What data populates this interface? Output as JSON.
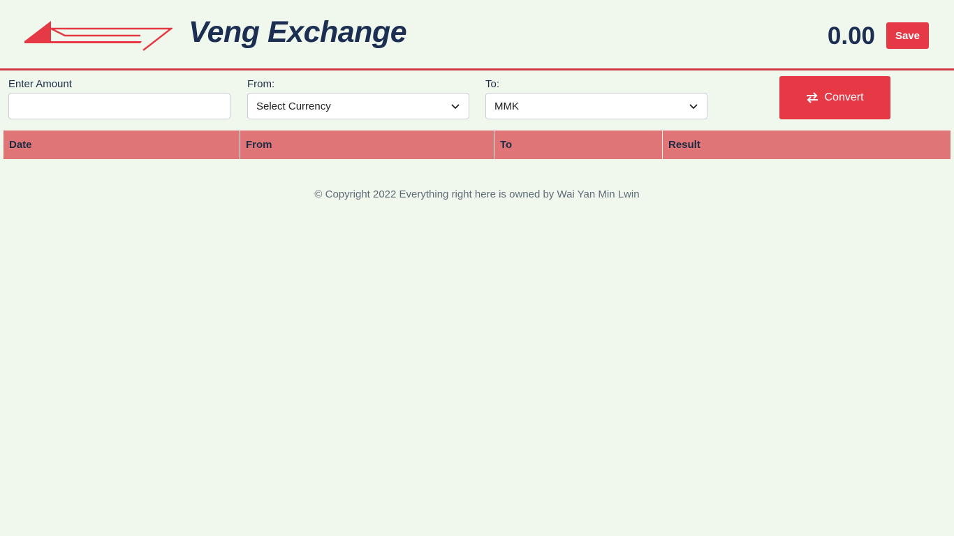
{
  "header": {
    "brand": "Veng Exchange",
    "total": "0.00",
    "save_label": "Save"
  },
  "form": {
    "amount_label": "Enter Amount",
    "amount_value": "",
    "from_label": "From:",
    "from_value": "Select Currency",
    "to_label": "To:",
    "to_value": "MMK",
    "convert_label": "Convert"
  },
  "table": {
    "columns": [
      "Date",
      "From",
      "To",
      "Result"
    ],
    "rows": []
  },
  "footer": {
    "text": "© Copyright 2022 Everything right here is owned by Wai Yan Min Lwin"
  },
  "colors": {
    "background": "#f0f8ee",
    "accent": "#e63946",
    "brand_text": "#1c2f52",
    "table_header": "#e07577"
  },
  "icons": {
    "logo": "arrow-logo-icon",
    "convert": "exchange-arrows-icon",
    "dropdown": "chevron-down-icon"
  }
}
